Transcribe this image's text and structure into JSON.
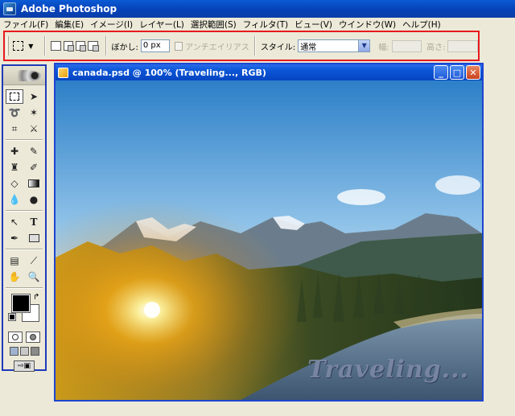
{
  "app": {
    "title": "Adobe Photoshop"
  },
  "menubar": {
    "items": [
      "ファイル(F)",
      "編集(E)",
      "イメージ(I)",
      "レイヤー(L)",
      "選択範囲(S)",
      "フィルタ(T)",
      "ビュー(V)",
      "ウインドウ(W)",
      "ヘルプ(H)"
    ]
  },
  "options": {
    "feather_label": "ぼかし:",
    "feather_value": "0 px",
    "antialias_label": "アンチエイリアス",
    "style_label": "スタイル:",
    "style_value": "通常",
    "width_label": "幅:",
    "height_label": "高さ:"
  },
  "document": {
    "title": "canada.psd @ 100% (Traveling..., RGB)",
    "watermark": "Traveling..."
  },
  "colors": {
    "foreground": "#000000",
    "background": "#ffffff",
    "accent_red": "#e8191e"
  }
}
